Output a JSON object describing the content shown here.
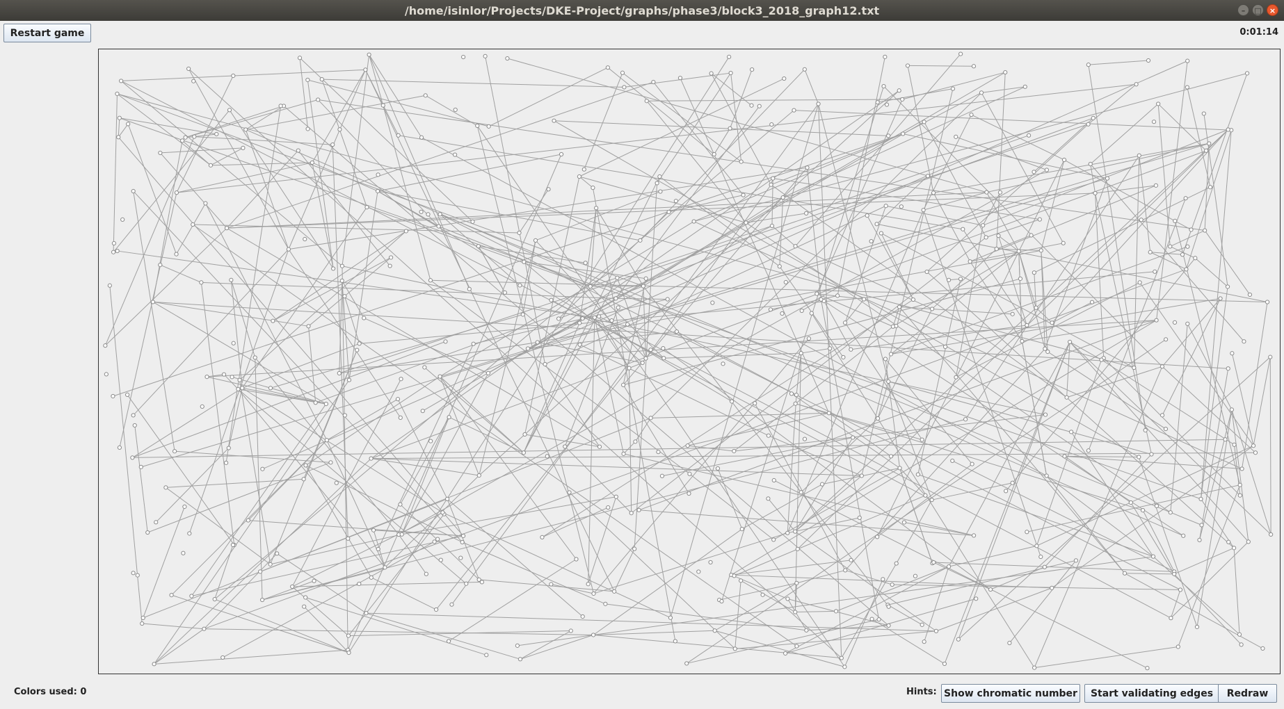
{
  "window": {
    "title": "/home/isinlor/Projects/DKE-Project/graphs/phase3/block3_2018_graph12.txt",
    "controls": [
      "minimize-icon",
      "maximize-icon",
      "close-icon"
    ]
  },
  "toolbar": {
    "restart_label": "Restart game",
    "timer": "0:01:14"
  },
  "graph": {
    "edge_color": "#a0a0a0",
    "vertex_fill": "#ffffff",
    "vertex_stroke": "#8a8a8a"
  },
  "footer": {
    "colors_used": "Colors used: 0",
    "hints_label": "Hints:",
    "show_chromatic_label": "Show chromatic number",
    "validate_edges_label": "Start validating edges",
    "redraw_label": "Redraw"
  }
}
